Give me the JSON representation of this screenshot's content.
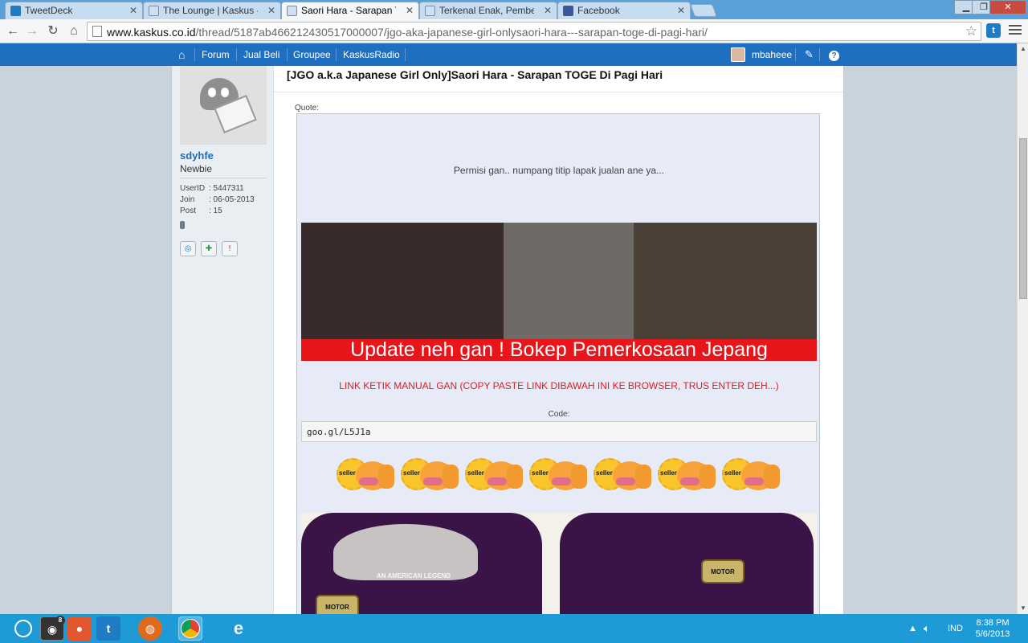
{
  "tabs": [
    {
      "title": "TweetDeck",
      "color": "#1d7cc4"
    },
    {
      "title": "The Lounge | Kaskus - The",
      "color": "#5a8fd0"
    },
    {
      "title": "Saori Hara - Sarapan TOGE",
      "color": "#5a8fd0"
    },
    {
      "title": "Terkenal Enak, Pembeli Te",
      "color": "#5a8fd0"
    },
    {
      "title": "Facebook",
      "color": "#3b5998"
    }
  ],
  "address": {
    "host": "www.kaskus.co.id",
    "path": "/thread/5187ab466212430517000007/jgo-aka-japanese-girl-onlysaori-hara---sarapan-toge-di-pagi-hari/"
  },
  "nav": {
    "items": [
      "Forum",
      "Jual Beli",
      "Groupee",
      "KaskusRadio"
    ],
    "user": "mbaheee",
    "accent": "#1f6fc0"
  },
  "user": {
    "name": "sdyhfe",
    "rank": "Newbie",
    "stats": [
      {
        "label": "UserID",
        "value": ": 5447311"
      },
      {
        "label": "Join",
        "value": ": 06-05-2013"
      },
      {
        "label": "Post",
        "value": ": 15"
      }
    ]
  },
  "post": {
    "title": "[JGO a.k.a Japanese Girl Only]Saori Hara - Sarapan TOGE Di Pagi Hari",
    "quote_label": "Quote:",
    "intro": "Permisi gan.. numpang titip lapak jualan ane ya...",
    "banner_caption": "Update neh gan ! Bokep Pemerkosaan Jepang",
    "red_note": "LINK KETIK MANUAL GAN (COPY PASTE LINK DIBAWAH INI KE BROWSER, TRUS ENTER DEH...)",
    "code_label": "Code:",
    "code_text": "goo.gl/L5J1a",
    "emote_tag": "seller",
    "emote_count": 7,
    "shirt_caption": "AN AMERICAN LEGEND",
    "shirt_logo": "MOTOR"
  },
  "taskbar": {
    "badge": "8",
    "lang": "IND",
    "time": "8:38 PM",
    "date": "5/6/2013"
  }
}
